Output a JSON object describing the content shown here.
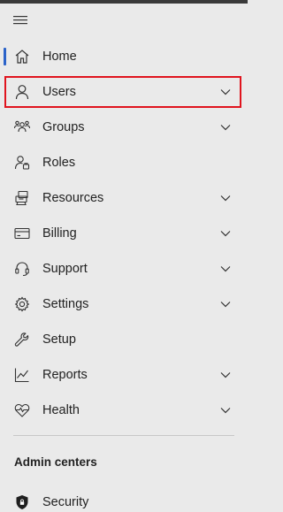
{
  "nav": {
    "items": [
      {
        "label": "Home",
        "icon": "home-icon",
        "expandable": false,
        "active": true
      },
      {
        "label": "Users",
        "icon": "user-icon",
        "expandable": true,
        "highlighted": true
      },
      {
        "label": "Groups",
        "icon": "groups-icon",
        "expandable": true
      },
      {
        "label": "Roles",
        "icon": "roles-icon",
        "expandable": false
      },
      {
        "label": "Resources",
        "icon": "resources-icon",
        "expandable": true
      },
      {
        "label": "Billing",
        "icon": "billing-icon",
        "expandable": true
      },
      {
        "label": "Support",
        "icon": "headset-icon",
        "expandable": true
      },
      {
        "label": "Settings",
        "icon": "gear-icon",
        "expandable": true
      },
      {
        "label": "Setup",
        "icon": "wrench-icon",
        "expandable": false
      },
      {
        "label": "Reports",
        "icon": "chart-icon",
        "expandable": true
      },
      {
        "label": "Health",
        "icon": "heart-pulse-icon",
        "expandable": true
      }
    ]
  },
  "admin_centers": {
    "title": "Admin centers",
    "items": [
      {
        "label": "Security",
        "icon": "shield-icon"
      }
    ]
  },
  "colors": {
    "background": "#eaeaea",
    "accent": "#2b63c9",
    "highlight_border": "#e0141e"
  }
}
